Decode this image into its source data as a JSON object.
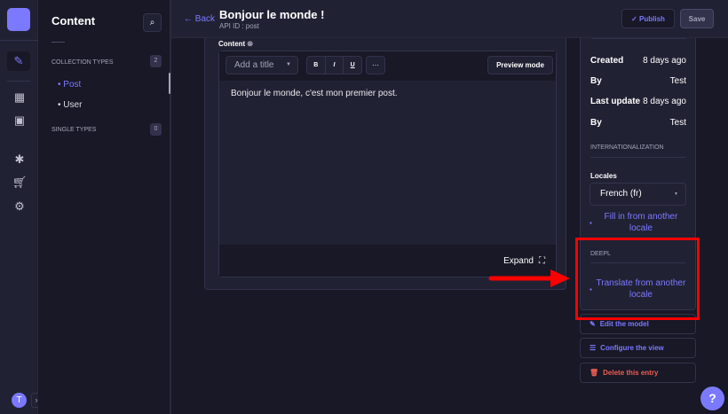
{
  "nav": {
    "items": [
      "content-manager",
      "content-type-builder",
      "media-library",
      "plugins",
      "marketplace",
      "settings"
    ],
    "avatar": "T"
  },
  "sidebar": {
    "title": "Content",
    "collection_label": "COLLECTION TYPES",
    "collection_count": "2",
    "collection_items": [
      "Post",
      "User"
    ],
    "single_label": "SINGLE TYPES",
    "single_count": "0"
  },
  "header": {
    "back": "Back",
    "title": "Bonjour le monde !",
    "subtitle": "API ID : post",
    "publish": "Publish",
    "save": "Save"
  },
  "editor": {
    "label": "Content",
    "heading_select": "Add a title",
    "bold": "B",
    "italic": "I",
    "underline": "U",
    "more": "···",
    "preview": "Preview mode",
    "body": "Bonjour le monde, c'est mon premier post.",
    "expand": "Expand"
  },
  "info": {
    "created_label": "Created",
    "created_value": "8 days ago",
    "by1_label": "By",
    "by1_value": "Test",
    "updated_label": "Last update",
    "updated_value": "8 days ago",
    "by2_label": "By",
    "by2_value": "Test"
  },
  "i18n": {
    "title": "INTERNATIONALIZATION",
    "locales_label": "Locales",
    "locale": "French (fr)",
    "fill": "Fill in from another locale"
  },
  "deepl": {
    "title": "DEEPL",
    "translate": "Translate from another locale"
  },
  "actions": {
    "edit_model": "Edit the model",
    "configure": "Configure the view",
    "delete": "Delete this entry"
  },
  "help": "?",
  "colors": {
    "accent": "#7b79ff",
    "danger": "#ee5e52",
    "highlight": "#ff0000"
  }
}
